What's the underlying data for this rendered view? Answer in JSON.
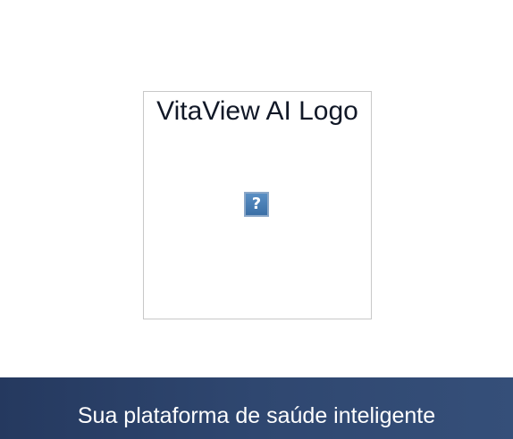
{
  "logo": {
    "alt_text": "VitaView AI Logo",
    "broken_image_glyph": "?",
    "icon": "broken-image-icon"
  },
  "footer": {
    "tagline": "Sua plataforma de saúde inteligente"
  },
  "colors": {
    "background": "#ffffff",
    "tagline_bar": "#2f4770",
    "tagline_text": "#ffffff",
    "logo_border": "#c8c8c8"
  }
}
